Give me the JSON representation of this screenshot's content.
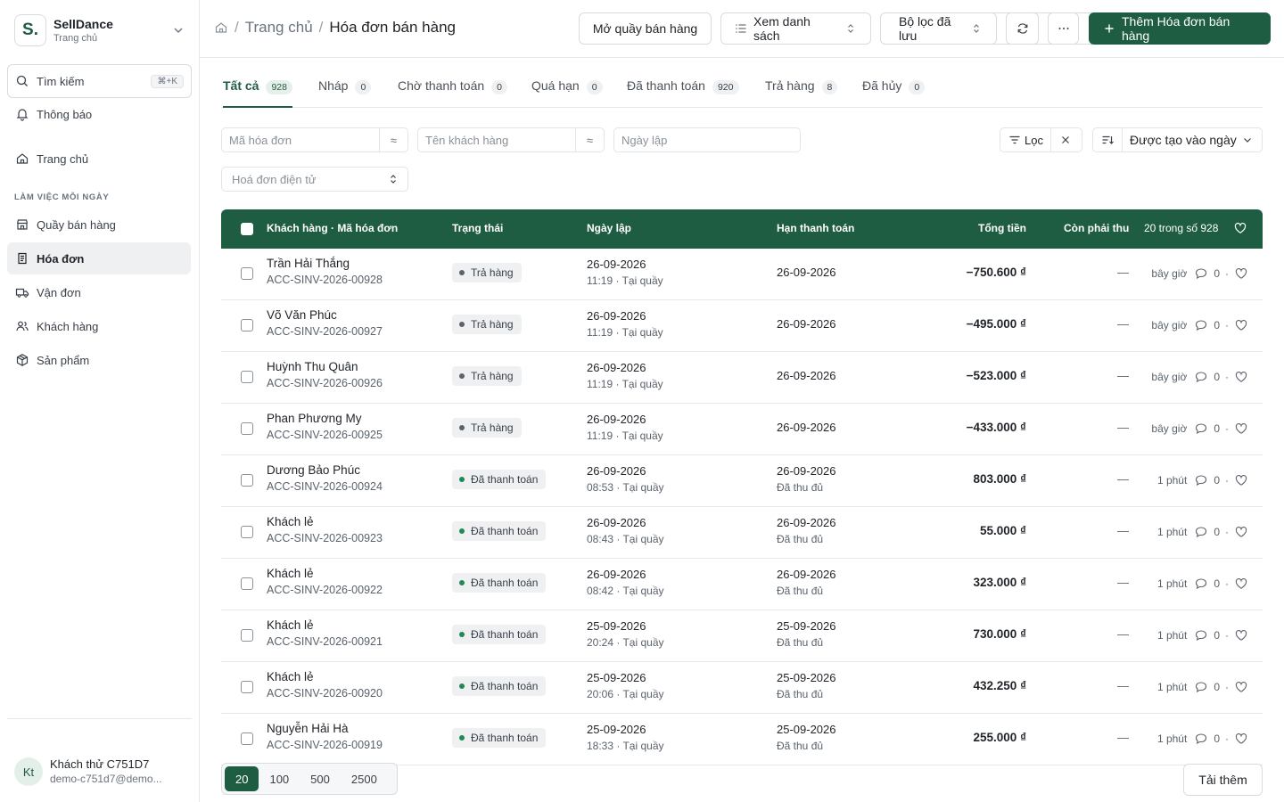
{
  "brand": {
    "logo": "S.",
    "name": "SellDance",
    "sub": "Trang chủ"
  },
  "sidebar": {
    "search_label": "Tìm kiếm",
    "search_shortcut": "⌘+K",
    "notifications": "Thông báo",
    "home": "Trang chủ",
    "section_label": "LÀM VIỆC MỖI NGÀY",
    "items": [
      {
        "label": "Quầy bán hàng",
        "icon": "store-icon"
      },
      {
        "label": "Hóa đơn",
        "icon": "receipt-icon",
        "active": true
      },
      {
        "label": "Vận đơn",
        "icon": "truck-icon"
      },
      {
        "label": "Khách hàng",
        "icon": "users-icon"
      },
      {
        "label": "Sản phẩm",
        "icon": "package-icon"
      }
    ],
    "user": {
      "initials": "Kt",
      "name": "Khách thử C751D7",
      "email": "demo-c751d7@demo..."
    }
  },
  "header": {
    "breadcrumb_home": "Trang chủ",
    "breadcrumb_current": "Hóa đơn bán hàng",
    "btn_open_counter": "Mở quầy bán hàng",
    "btn_view_list": "Xem danh sách",
    "btn_saved_filters": "Bộ lọc đã lưu",
    "btn_add": "Thêm Hóa đơn bán hàng"
  },
  "tabs": [
    {
      "label": "Tất cả",
      "count": "928",
      "active": true
    },
    {
      "label": "Nháp",
      "count": "0"
    },
    {
      "label": "Chờ thanh toán",
      "count": "0"
    },
    {
      "label": "Quá hạn",
      "count": "0"
    },
    {
      "label": "Đã thanh toán",
      "count": "920"
    },
    {
      "label": "Trả hàng",
      "count": "8"
    },
    {
      "label": "Đã hủy",
      "count": "0"
    }
  ],
  "filters": {
    "invoice_code_placeholder": "Mã hóa đơn",
    "customer_name_placeholder": "Tên khách hàng",
    "date_placeholder": "Ngày lập",
    "einvoice_placeholder": "Hoá đơn điện tử",
    "op_symbol": "≈",
    "filter_label": "Lọc",
    "sort_label": "Được tạo vào ngày"
  },
  "table": {
    "headers": {
      "customer": "Khách hàng · Mã hóa đơn",
      "status": "Trạng thái",
      "date": "Ngày lập",
      "due": "Hạn thanh toán",
      "total": "Tổng tiền",
      "remaining": "Còn phải thu",
      "count": "20 trong số 928"
    },
    "status_colors": {
      "Trả hàng": "#5a626b",
      "Đã thanh toán": "#1f8a55"
    },
    "rows": [
      {
        "customer": "Trần Hải Thắng",
        "code": "ACC-SINV-2026-00928",
        "status": "Trả hàng",
        "date": "26-09-2026",
        "time": "11:19 · Tại quầy",
        "due": "26-09-2026",
        "due_note": "",
        "total": "−750.600 ₫",
        "remaining": "—",
        "ago": "bây giờ",
        "comments": "0"
      },
      {
        "customer": "Võ Văn Phúc",
        "code": "ACC-SINV-2026-00927",
        "status": "Trả hàng",
        "date": "26-09-2026",
        "time": "11:19 · Tại quầy",
        "due": "26-09-2026",
        "due_note": "",
        "total": "−495.000 ₫",
        "remaining": "—",
        "ago": "bây giờ",
        "comments": "0"
      },
      {
        "customer": "Huỳnh Thu Quân",
        "code": "ACC-SINV-2026-00926",
        "status": "Trả hàng",
        "date": "26-09-2026",
        "time": "11:19 · Tại quầy",
        "due": "26-09-2026",
        "due_note": "",
        "total": "−523.000 ₫",
        "remaining": "—",
        "ago": "bây giờ",
        "comments": "0"
      },
      {
        "customer": "Phan Phương My",
        "code": "ACC-SINV-2026-00925",
        "status": "Trả hàng",
        "date": "26-09-2026",
        "time": "11:19 · Tại quầy",
        "due": "26-09-2026",
        "due_note": "",
        "total": "−433.000 ₫",
        "remaining": "—",
        "ago": "bây giờ",
        "comments": "0"
      },
      {
        "customer": "Dương Bảo Phúc",
        "code": "ACC-SINV-2026-00924",
        "status": "Đã thanh toán",
        "date": "26-09-2026",
        "time": "08:53 · Tại quầy",
        "due": "26-09-2026",
        "due_note": "Đã thu đủ",
        "total": "803.000 ₫",
        "remaining": "—",
        "ago": "1 phút",
        "comments": "0"
      },
      {
        "customer": "Khách lẻ",
        "code": "ACC-SINV-2026-00923",
        "status": "Đã thanh toán",
        "date": "26-09-2026",
        "time": "08:43 · Tại quầy",
        "due": "26-09-2026",
        "due_note": "Đã thu đủ",
        "total": "55.000 ₫",
        "remaining": "—",
        "ago": "1 phút",
        "comments": "0"
      },
      {
        "customer": "Khách lẻ",
        "code": "ACC-SINV-2026-00922",
        "status": "Đã thanh toán",
        "date": "26-09-2026",
        "time": "08:42 · Tại quầy",
        "due": "26-09-2026",
        "due_note": "Đã thu đủ",
        "total": "323.000 ₫",
        "remaining": "—",
        "ago": "1 phút",
        "comments": "0"
      },
      {
        "customer": "Khách lẻ",
        "code": "ACC-SINV-2026-00921",
        "status": "Đã thanh toán",
        "date": "25-09-2026",
        "time": "20:24 · Tại quầy",
        "due": "25-09-2026",
        "due_note": "Đã thu đủ",
        "total": "730.000 ₫",
        "remaining": "—",
        "ago": "1 phút",
        "comments": "0"
      },
      {
        "customer": "Khách lẻ",
        "code": "ACC-SINV-2026-00920",
        "status": "Đã thanh toán",
        "date": "25-09-2026",
        "time": "20:06 · Tại quầy",
        "due": "25-09-2026",
        "due_note": "Đã thu đủ",
        "total": "432.250 ₫",
        "remaining": "—",
        "ago": "1 phút",
        "comments": "0"
      },
      {
        "customer": "Nguyễn Hải Hà",
        "code": "ACC-SINV-2026-00919",
        "status": "Đã thanh toán",
        "date": "25-09-2026",
        "time": "18:33 · Tại quầy",
        "due": "25-09-2026",
        "due_note": "Đã thu đủ",
        "total": "255.000 ₫",
        "remaining": "—",
        "ago": "1 phút",
        "comments": "0"
      }
    ]
  },
  "pager": {
    "sizes": [
      "20",
      "100",
      "500",
      "2500"
    ],
    "active": "20"
  },
  "load_more": "Tải thêm"
}
